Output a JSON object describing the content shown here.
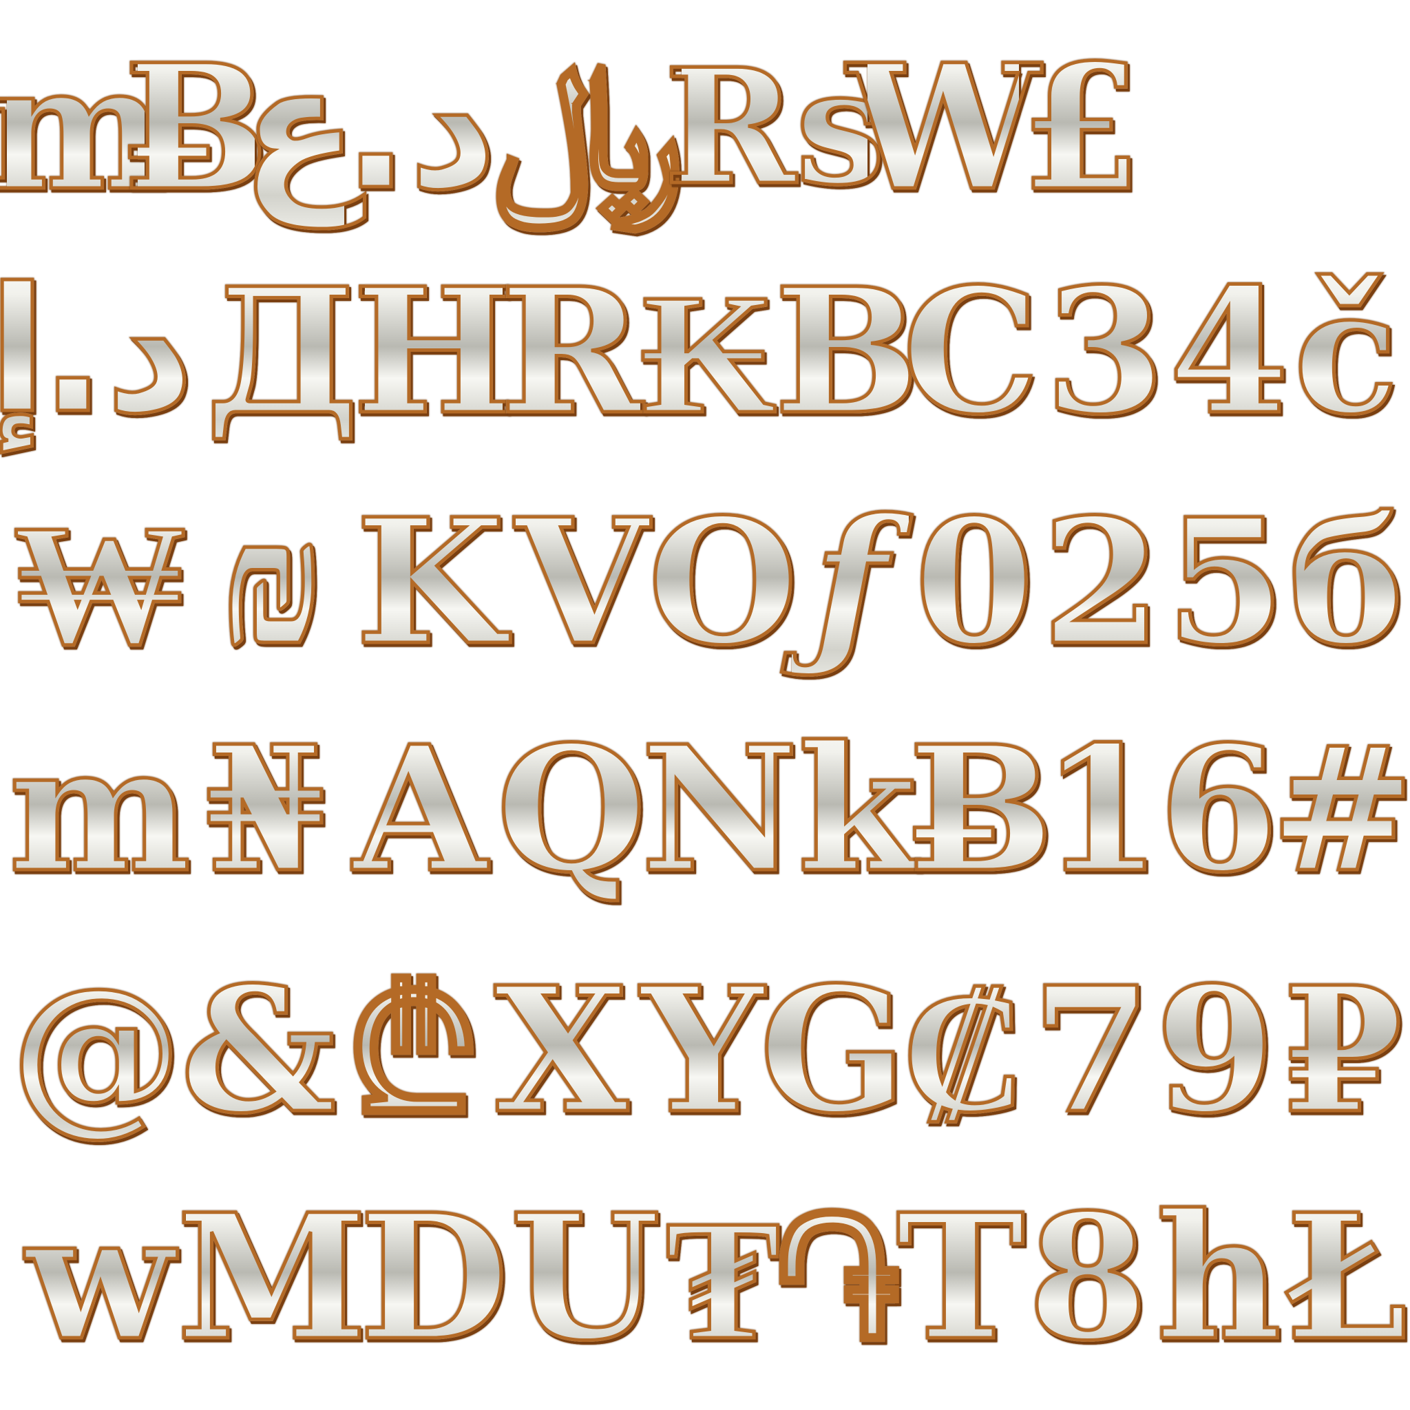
{
  "rows": [
    [
      "m",
      "Ƀ",
      "ع",
      ".د",
      "﷼",
      "Rs",
      "W",
      "£"
    ],
    [
      "إ",
      ".د",
      "Д",
      "H",
      "R",
      "₭",
      "B",
      "C",
      "3",
      "4",
      "č"
    ],
    [
      "₩",
      "₪",
      "K",
      "V",
      "O",
      "ƒ",
      "0",
      "2",
      "5",
      "б"
    ],
    [
      "m",
      "₦",
      "A",
      "Q",
      "N",
      "k",
      "Ƀ",
      "1",
      "6",
      "#"
    ],
    [
      "@",
      "&",
      "₾",
      "X",
      "Y",
      "G",
      "₡",
      "7",
      "9",
      "₽"
    ],
    [
      "w",
      "M",
      "D",
      "U",
      "₮",
      "֏",
      "T",
      "8",
      "h",
      "Ł"
    ]
  ],
  "colors": {
    "face": "#e6e6e0",
    "outline": "#b46a26",
    "shadow": "#7a3f10",
    "background": "#ffffff"
  }
}
